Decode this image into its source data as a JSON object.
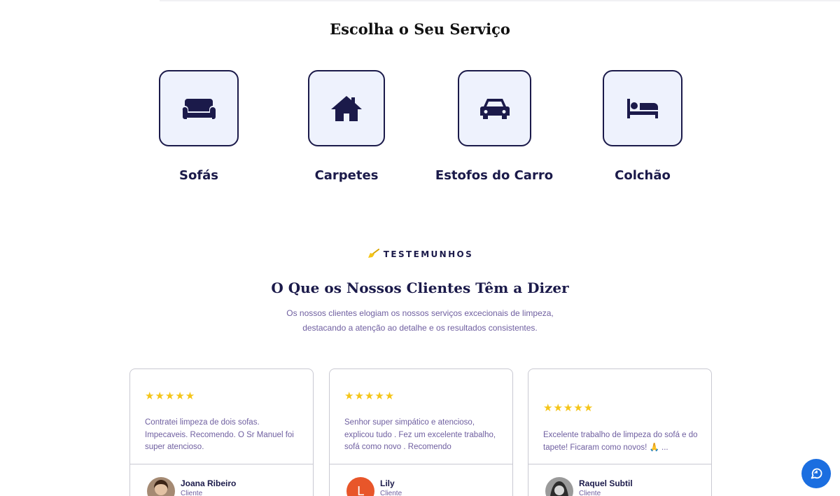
{
  "services": {
    "title": "Escolha o Seu Serviço",
    "items": [
      {
        "label": "Sofás",
        "icon": "sofa-icon"
      },
      {
        "label": "Carpetes",
        "icon": "house-icon"
      },
      {
        "label": "Estofos do Carro",
        "icon": "car-icon"
      },
      {
        "label": "Colchão",
        "icon": "bed-icon"
      }
    ]
  },
  "testimonials": {
    "badge": "TESTEMUNHOS",
    "badge_icon": "broom-icon",
    "title": "O Que os Nossos Clientes Têm a Dizer",
    "subtitle_line1": "Os nossos clientes elogiam os nossos serviços excecionais de limpeza,",
    "subtitle_line2": "destacando a atenção ao detalhe e os resultados consistentes.",
    "cards": [
      {
        "stars": "★★★★★",
        "rating": 5,
        "text": "Contratei limpeza de dois sofas. Impecaveis. Recomendo. O Sr Manuel foi super atencioso.",
        "name": "Joana Ribeiro",
        "role": "Cliente"
      },
      {
        "stars": "★★★★★",
        "rating": 5,
        "text": "Senhor super simpático e atencioso, explicou tudo . Fez um excelente trabalho, sofá como novo . Recomendo",
        "name": "Lily",
        "role": "Cliente",
        "avatar_initial": "L"
      },
      {
        "stars": "★★★★★",
        "rating": 5,
        "text": "Excelente trabalho de limpeza do sofá e do tapete! Ficaram como novos! 🙏 ...",
        "name": "Raquel Subtil",
        "role": "Cliente"
      }
    ]
  },
  "colors": {
    "primary": "#1b1a4a",
    "accent": "#1b6ee0",
    "star": "#f5c518",
    "tile_bg": "#eef2fd"
  },
  "chat": {
    "icon": "chat-icon"
  }
}
